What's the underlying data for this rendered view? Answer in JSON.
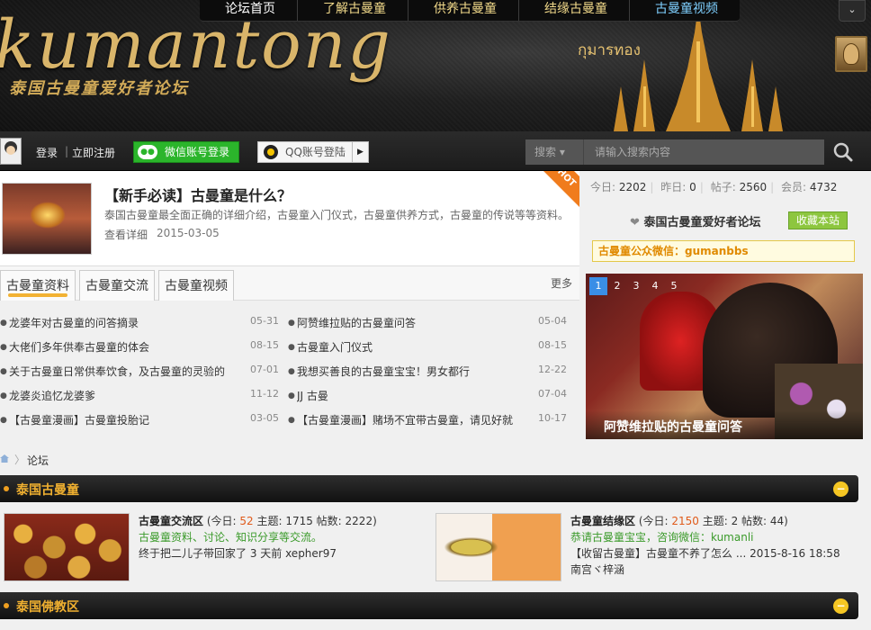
{
  "topnav": {
    "items": [
      {
        "label": "论坛首页"
      },
      {
        "label": "了解古曼童"
      },
      {
        "label": "供养古曼童"
      },
      {
        "label": "结缘古曼童"
      },
      {
        "label": "古曼童视频"
      }
    ],
    "toggle_icon": "chevron-down-icon"
  },
  "banner": {
    "logo_word": "kumantong",
    "logo_subtitle": "泰国古曼童爱好者论坛",
    "thai_text": "กุมารทอง"
  },
  "loginbar": {
    "login": "登录",
    "register": "立即注册",
    "separator": "|",
    "wechat_login": "微信账号登录",
    "qq_login": "QQ账号登陆",
    "search_type": "搜索 ▾",
    "search_placeholder": "请输入搜索内容"
  },
  "featured": {
    "title": "【新手必读】古曼童是什么？",
    "description": "泰国古曼童最全面正确的详细介绍，古曼童入门仪式，古曼童供养方式，古曼童的传说等等资料。",
    "more": "查看详细",
    "date": "2015-03-05",
    "badge": "HOT"
  },
  "tabs": {
    "items": [
      {
        "label": "古曼童资料"
      },
      {
        "label": "古曼童交流"
      },
      {
        "label": "古曼童视频"
      }
    ],
    "more": "更多"
  },
  "posts_left": [
    {
      "title": "龙婆年对古曼童的问答摘录",
      "date": "05-31"
    },
    {
      "title": "大佬们多年供奉古曼童的体会",
      "date": "08-15"
    },
    {
      "title": "关于古曼童日常供奉饮食，及古曼童的灵验的",
      "date": "07-01"
    },
    {
      "title": "龙婆炎追忆龙婆爹",
      "date": "11-12"
    },
    {
      "title": "【古曼童漫画】古曼童投胎记",
      "date": "03-05"
    }
  ],
  "posts_right": [
    {
      "title": "阿赞维拉贴的古曼童问答",
      "date": "05-04"
    },
    {
      "title": "古曼童入门仪式",
      "date": "08-15"
    },
    {
      "title": "我想买善良的古曼童宝宝！男女都行",
      "date": "12-22"
    },
    {
      "title": "JJ 古曼",
      "date": "07-04"
    },
    {
      "title": "【古曼童漫画】赌场不宜带古曼童，请见好就",
      "date": "10-17"
    }
  ],
  "stats": {
    "today_label": "今日:",
    "today": "2202",
    "yesterday_label": "昨日:",
    "yesterday": "0",
    "posts_label": "帖子:",
    "posts": "2560",
    "members_label": "会员:",
    "members": "4732"
  },
  "forum_info": {
    "name": "泰国古曼童爱好者论坛",
    "favorite": "收藏本站",
    "wechat_notice": "古曼童公众微信：gumanbbs"
  },
  "slideshow": {
    "pages": [
      "1",
      "2",
      "3",
      "4",
      "5"
    ],
    "active": 0,
    "caption": "阿赞维拉贴的古曼童问答"
  },
  "breadcrumb": {
    "label": "论坛",
    "arrow": "〉"
  },
  "categories": [
    {
      "name": "泰国古曼童",
      "collapse": "−",
      "forums": [
        {
          "name": "古曼童交流区",
          "today_prefix": " (今日: ",
          "today": "52",
          "stats_suffix": " 主题: 1715 帖数: 2222)",
          "desc": "古曼童资料、讨论、知识分享等交流。",
          "last": "终于把二儿子带回家了 3 天前 xepher97"
        },
        {
          "name": "古曼童结缘区",
          "today_prefix": " (今日: ",
          "today": "2150",
          "stats_suffix": " 主题: 2 帖数: 44)",
          "desc": "恭请古曼童宝宝，咨询微信：kumanli",
          "last": "【收留古曼童】古曼童不养了怎么 ... 2015-8-16 18:58 南宫ヾ梓涵"
        }
      ]
    },
    {
      "name": "泰国佛教区",
      "collapse": "−"
    }
  ]
}
